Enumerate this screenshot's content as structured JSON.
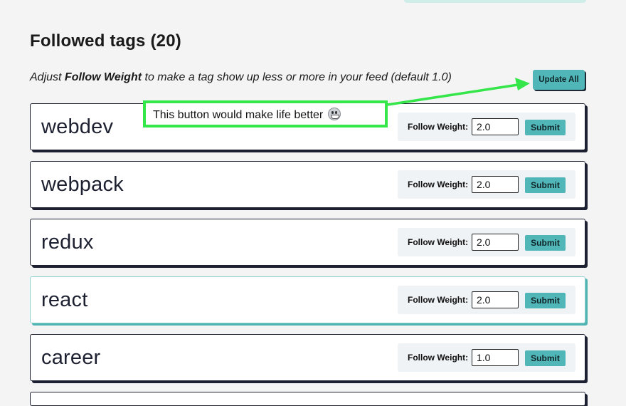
{
  "page": {
    "heading": "Followed tags (20)",
    "instructions": {
      "prefix": "Adjust ",
      "emphasis": "Follow Weight",
      "suffix": " to make a tag show up less or more in your feed (default 1.0)"
    },
    "update_all_label": "Update All"
  },
  "annotation": {
    "text": "This button would make life better",
    "icon": "grinning-face-icon",
    "color": "#35e64a"
  },
  "tags": [
    {
      "name": "webdev",
      "weight_label": "Follow Weight:",
      "weight": "2.0",
      "submit_label": "Submit"
    },
    {
      "name": "webpack",
      "weight_label": "Follow Weight:",
      "weight": "2.0",
      "submit_label": "Submit"
    },
    {
      "name": "redux",
      "weight_label": "Follow Weight:",
      "weight": "2.0",
      "submit_label": "Submit"
    },
    {
      "name": "react",
      "weight_label": "Follow Weight:",
      "weight": "2.0",
      "submit_label": "Submit"
    },
    {
      "name": "career",
      "weight_label": "Follow Weight:",
      "weight": "1.0",
      "submit_label": "Submit"
    }
  ],
  "colors": {
    "accent": "#51b6b7",
    "card_border": "#1d2030",
    "hover_border": "#4fb3b1",
    "background": "#f4f4f5"
  }
}
